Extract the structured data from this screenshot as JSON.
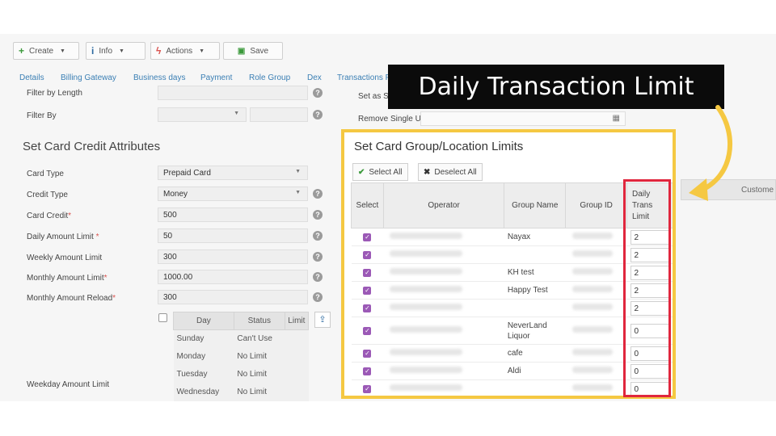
{
  "toolbar": {
    "create_label": "Create",
    "info_label": "Info",
    "actions_label": "Actions",
    "save_label": "Save"
  },
  "tabs": [
    "Details",
    "Billing Gateway",
    "Business days",
    "Payment",
    "Role Group",
    "Dex",
    "Transactions F"
  ],
  "filters": {
    "filter_by_length": "Filter by Length",
    "filter_by": "Filter By",
    "set_as": "Set as Si",
    "remove_single_use": "Remove Single Use"
  },
  "section_title": "Set Card Credit Attributes",
  "fields": [
    {
      "label": "Card Type",
      "value": "Prepaid Card",
      "required": false
    },
    {
      "label": "Credit Type",
      "value": "Money",
      "required": false
    },
    {
      "label": "Card Credit",
      "value": "500",
      "required": true
    },
    {
      "label": "Daily Amount Limit ",
      "value": "50",
      "required": true
    },
    {
      "label": "Weekly Amount Limit",
      "value": "300",
      "required": false
    },
    {
      "label": "Monthly Amount Limit",
      "value": "1000.00",
      "required": true
    },
    {
      "label": "Monthly Amount Reload",
      "value": "300",
      "required": true
    }
  ],
  "weekday": {
    "label": "Weekday Amount Limit",
    "headers": [
      "Day",
      "Status",
      "Limit"
    ],
    "rows": [
      {
        "day": "Sunday",
        "status": "Can't Use"
      },
      {
        "day": "Monday",
        "status": "No Limit"
      },
      {
        "day": "Tuesday",
        "status": "No Limit"
      },
      {
        "day": "Wednesday",
        "status": "No Limit"
      }
    ]
  },
  "right_column_partial": "Custome",
  "panel": {
    "title": "Set Card Group/Location Limits",
    "select_all": "Select All",
    "deselect_all": "Deselect All",
    "headers": [
      "Select",
      "Operator",
      "Group Name",
      "Group ID",
      "Daily Trans Limit"
    ],
    "rows": [
      {
        "group_name": "Nayax",
        "limit": "2"
      },
      {
        "group_name": "",
        "limit": "2"
      },
      {
        "group_name": "KH test",
        "limit": "2"
      },
      {
        "group_name": "Happy Test",
        "limit": "2"
      },
      {
        "group_name": "",
        "limit": "2"
      },
      {
        "group_name": "NeverLand Liquor",
        "limit": "0"
      },
      {
        "group_name": "cafe",
        "limit": "0"
      },
      {
        "group_name": "Aldi",
        "limit": "0"
      },
      {
        "group_name": "",
        "limit": "0"
      }
    ]
  },
  "callout": "Daily Transaction Limit",
  "colors": {
    "highlight_yellow": "#f5c842",
    "highlight_red": "#e0263d",
    "checkbox_purple": "#9b59b6",
    "tab_blue": "#3b7fb4"
  }
}
